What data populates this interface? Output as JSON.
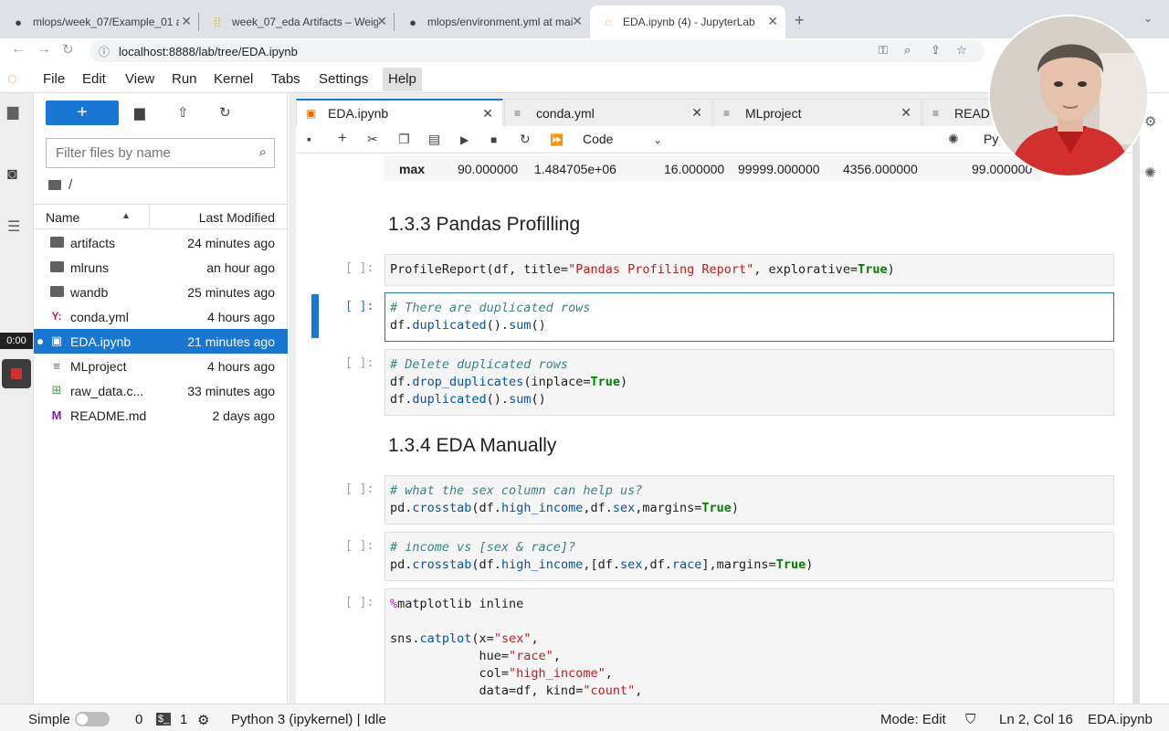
{
  "browser": {
    "tabs": [
      {
        "title": "mlops/week_07/Example_01 at",
        "icon": "github-icon"
      },
      {
        "title": "week_07_eda Artifacts – Weig",
        "icon": "wandb-icon"
      },
      {
        "title": "mlops/environment.yml at mai",
        "icon": "github-icon"
      },
      {
        "title": "EDA.ipynb (4) - JupyterLab",
        "icon": "jupyter-icon",
        "active": true
      }
    ],
    "url": "localhost:8888/lab/tree/EDA.ipynb"
  },
  "menu": [
    "File",
    "Edit",
    "View",
    "Run",
    "Kernel",
    "Tabs",
    "Settings",
    "Help"
  ],
  "activity": {
    "timer": "0:00"
  },
  "filebrowser": {
    "filter_placeholder": "Filter files by name",
    "breadcrumb": "/",
    "col_name": "Name",
    "col_modified": "Last Modified",
    "files": [
      {
        "name": "artifacts",
        "modified": "24 minutes ago",
        "type": "folder"
      },
      {
        "name": "mlruns",
        "modified": "an hour ago",
        "type": "folder"
      },
      {
        "name": "wandb",
        "modified": "25 minutes ago",
        "type": "folder"
      },
      {
        "name": "conda.yml",
        "modified": "4 hours ago",
        "type": "yaml"
      },
      {
        "name": "EDA.ipynb",
        "modified": "21 minutes ago",
        "type": "notebook",
        "selected": true
      },
      {
        "name": "MLproject",
        "modified": "4 hours ago",
        "type": "file"
      },
      {
        "name": "raw_data.c...",
        "modified": "33 minutes ago",
        "type": "csv"
      },
      {
        "name": "README.md",
        "modified": "2 days ago",
        "type": "markdown"
      }
    ]
  },
  "notebook": {
    "tabs": [
      {
        "title": "EDA.ipynb",
        "active": true
      },
      {
        "title": "conda.yml"
      },
      {
        "title": "MLproject"
      },
      {
        "title": "READM"
      }
    ],
    "cell_type": "Code",
    "kernel": "Py",
    "df_row": {
      "label": "max",
      "values": [
        "90.000000",
        "1.484705e+06",
        "16.000000",
        "99999.000000",
        "4356.000000",
        "99.000000"
      ]
    },
    "heading1": "1.3.3 Pandas Profilling",
    "heading2": "1.3.4 EDA Manually",
    "prompt": "[ ]:"
  },
  "statusbar": {
    "mode_label": "Simple",
    "count0": "0",
    "count1": "1",
    "kernel_status": "Python 3 (ipykernel) | Idle",
    "mode": "Mode: Edit",
    "position": "Ln 2, Col 16",
    "filename": "EDA.ipynb"
  }
}
